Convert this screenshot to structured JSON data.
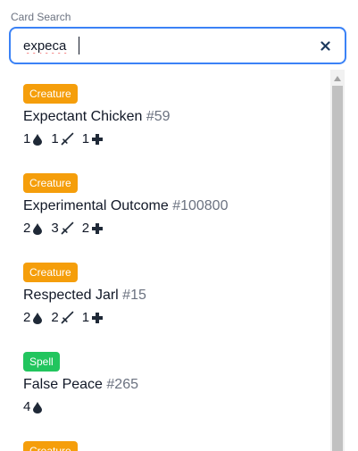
{
  "search": {
    "label": "Card Search",
    "value": "expeca"
  },
  "results": [
    {
      "type": "Creature",
      "name": "Expectant Chicken",
      "id": "#59",
      "cost": "1",
      "attack": "1",
      "health": "1"
    },
    {
      "type": "Creature",
      "name": "Experimental Outcome",
      "id": "#100800",
      "cost": "2",
      "attack": "3",
      "health": "2"
    },
    {
      "type": "Creature",
      "name": "Respected Jarl",
      "id": "#15",
      "cost": "2",
      "attack": "2",
      "health": "1"
    },
    {
      "type": "Spell",
      "name": "False Peace",
      "id": "#265",
      "cost": "4"
    },
    {
      "type": "Creature"
    }
  ],
  "colors": {
    "creature_badge": "#f59e0b",
    "spell_badge": "#22c55e",
    "focus_border": "#3b82f6"
  },
  "icons": {
    "cost": "drop-icon",
    "attack": "sword-icon",
    "health": "plus-icon",
    "clear": "close-icon"
  }
}
